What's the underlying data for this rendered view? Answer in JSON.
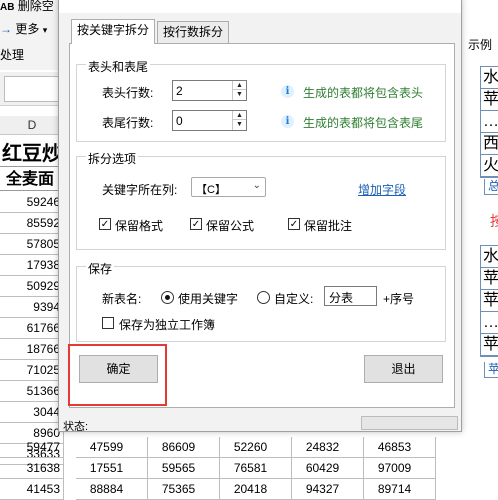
{
  "background": {
    "toolbar": {
      "delete_label": "删除空",
      "more_label": "更多",
      "process_label": "处理"
    },
    "column_header": "D",
    "sheet_title": "红豆炒",
    "column_label": "全麦面",
    "column_d_values": [
      "59246",
      "85592",
      "57805",
      "17938",
      "50929",
      "9394",
      "61766",
      "18766",
      "71025",
      "51366",
      "3044",
      "8960",
      "33633"
    ],
    "bottom_rows": [
      [
        "59477",
        "47599",
        "86609",
        "52260",
        "24832",
        "46853"
      ],
      [
        "31638",
        "17551",
        "59565",
        "76581",
        "60429",
        "97009"
      ],
      [
        "41453",
        "88884",
        "75365",
        "20418",
        "94327",
        "89714"
      ]
    ]
  },
  "dialog": {
    "tabs": [
      "按关键字拆分",
      "按行数拆分"
    ],
    "active_tab": 0,
    "header_footer": {
      "title": "表头和表尾",
      "header_rows_label": "表头行数:",
      "header_rows_value": "2",
      "header_hint": "生成的表都将包含表头",
      "footer_rows_label": "表尾行数:",
      "footer_rows_value": "0",
      "footer_hint": "生成的表都将包含表尾"
    },
    "split_options": {
      "title": "拆分选项",
      "key_column_label": "关键字所在列:",
      "key_column_value": "【C】",
      "add_field_link": "增加字段",
      "keep_format_label": "保留格式",
      "keep_formula_label": "保留公式",
      "keep_comment_label": "保留批注",
      "keep_format_checked": true,
      "keep_formula_checked": true,
      "keep_comment_checked": true
    },
    "save": {
      "title": "保存",
      "new_sheet_name_label": "新表名:",
      "use_keyword_label": "使用关键字",
      "custom_label": "自定义:",
      "custom_value": "分表",
      "suffix_label": "+序号",
      "separate_workbook_label": "保存为独立工作簿",
      "use_keyword_selected": true,
      "separate_workbook_checked": false
    },
    "ok_button": "确定",
    "exit_button": "退出",
    "status_label": "状态:"
  },
  "preview": {
    "title": "示例",
    "box1_rows": [
      "水",
      "苹",
      "…",
      "西",
      "火"
    ],
    "box1_tab": "总",
    "red_label": "按",
    "box2_rows": [
      "水",
      "苹",
      "苹",
      "…",
      "苹"
    ],
    "box2_tab": "苹"
  },
  "colors": {
    "hint_green": "#2e7d32",
    "link_blue": "#1a5fb4",
    "highlight_red": "#e53935"
  }
}
